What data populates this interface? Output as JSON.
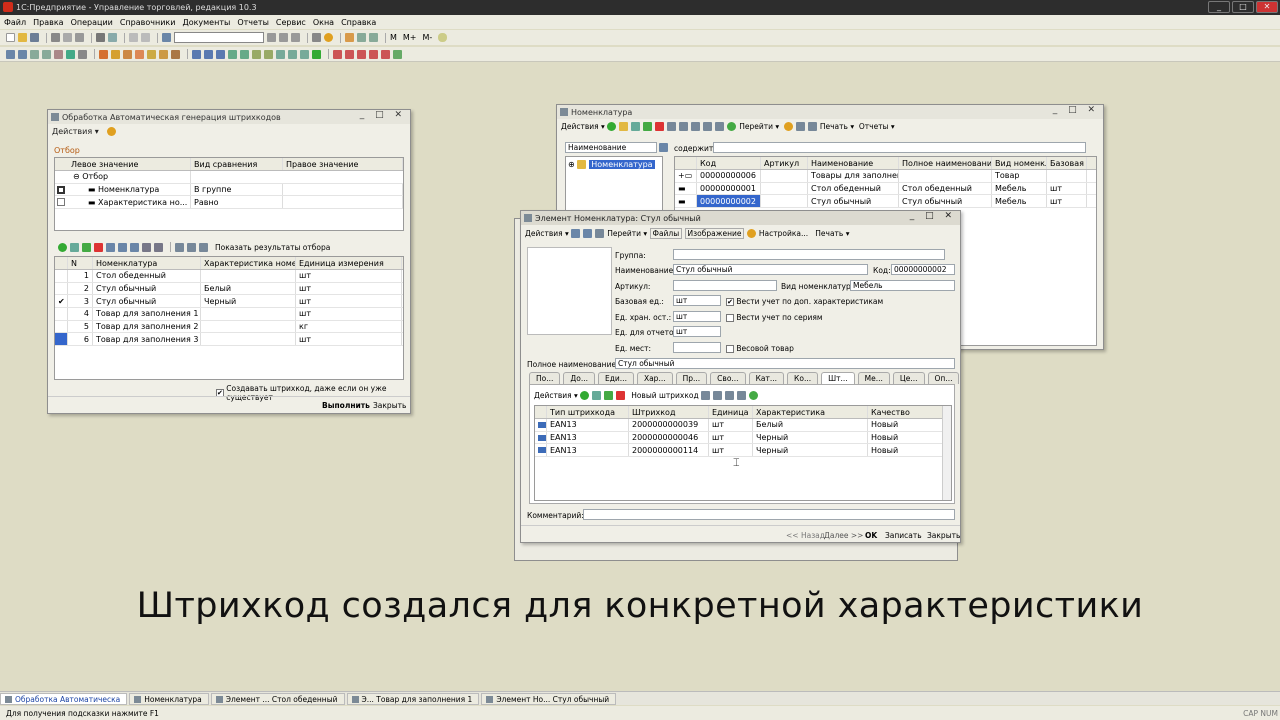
{
  "app": {
    "title": "1С:Предприятие - Управление торговлей, редакция 10.3",
    "menu": [
      "Файл",
      "Правка",
      "Операции",
      "Справочники",
      "Документы",
      "Отчеты",
      "Сервис",
      "Окна",
      "Справка"
    ],
    "toolbar_text": [
      "М",
      "М+",
      "М-"
    ]
  },
  "gen_window": {
    "title": "Обработка  Автоматическая генерация штрихкодов",
    "actions": "Действия",
    "filter_label": "Отбор",
    "filter_cols": [
      "Левое значение",
      "Вид сравнения",
      "Правое значение"
    ],
    "filter_root": "Отбор",
    "filters": [
      {
        "left": "Номенклатура",
        "cmp": "В группе",
        "right": ""
      },
      {
        "left": "Характеристика но...",
        "cmp": "Равно",
        "right": ""
      }
    ],
    "show_results": "Показать результаты отбора",
    "cols": [
      "N",
      "Номенклатура",
      "Характеристика номенк...",
      "Единица измерения"
    ],
    "rows": [
      {
        "n": "1",
        "name": "Стол обеденный",
        "char": "",
        "unit": "шт",
        "checked": false
      },
      {
        "n": "2",
        "name": "Стул обычный",
        "char": "Белый",
        "unit": "шт",
        "checked": false
      },
      {
        "n": "3",
        "name": "Стул обычный",
        "char": "Черный",
        "unit": "шт",
        "checked": true
      },
      {
        "n": "4",
        "name": "Товар для заполнения 1",
        "char": "",
        "unit": "шт",
        "checked": false
      },
      {
        "n": "5",
        "name": "Товар для заполнения 2",
        "char": "",
        "unit": "кг",
        "checked": false
      },
      {
        "n": "6",
        "name": "Товар для заполнения 3",
        "char": "",
        "unit": "шт",
        "checked": false
      }
    ],
    "create_note": "Создавать штрихкод, даже если он уже существует",
    "run": "Выполнить",
    "close": "Закрыть"
  },
  "nom_window": {
    "title": "Номенклатура",
    "toolbar": [
      "Действия",
      "Перейти",
      "Печать",
      "Отчеты"
    ],
    "search_field": "Наименование",
    "contains": "содержит:",
    "tree_root": "Номенклатура",
    "cols": [
      "Код",
      "Артикул",
      "Наименование",
      "Полное наименование",
      "Вид номенкл...",
      "Базовая ед..."
    ],
    "rows": [
      {
        "code": "00000000006",
        "art": "",
        "name": "Товары для заполнения",
        "full": "",
        "kind": "Товар",
        "unit": ""
      },
      {
        "code": "00000000001",
        "art": "",
        "name": "Стол обеденный",
        "full": "Стол обеденный",
        "kind": "Мебель",
        "unit": "шт"
      },
      {
        "code": "00000000002",
        "art": "",
        "name": "Стул обычный",
        "full": "Стул обычный",
        "kind": "Мебель",
        "unit": "шт"
      }
    ]
  },
  "el_window": {
    "title": "Элемент Номенклатура: Стул обычный",
    "toolbar": [
      "Действия",
      "Перейти",
      "Файлы",
      "Изображение",
      "Настройка...",
      "Печать"
    ],
    "group_label": "Группа:",
    "name_label": "Наименование:",
    "name_value": "Стул обычный",
    "code_label": "Код:",
    "code_value": "00000000002",
    "art_label": "Артикул:",
    "kind_label": "Вид номенклатуры:",
    "kind_value": "Мебель",
    "base_label": "Базовая ед.:",
    "base_value": "шт",
    "store_label": "Ед. хран. ост.:",
    "store_value": "шт",
    "report_label": "Ед. для отчетов:",
    "report_value": "шт",
    "place_label": "Ед. мест:",
    "chk_char": "Вести учет по доп. характеристикам",
    "chk_series": "Вести учет по сериям",
    "chk_weight": "Весовой товар",
    "full_label": "Полное наименование:",
    "full_value": "Стул обычный",
    "tabs": [
      "По...",
      "До...",
      "Еди...",
      "Хар...",
      "Пр...",
      "Сво...",
      "Кат...",
      "Ко...",
      "Шт...",
      "Ме...",
      "Це...",
      "Оп..."
    ],
    "sub_actions": "Действия",
    "new_barcode": "Новый штрихкод",
    "bc_cols": [
      "Тип штрихкода",
      "Штрихкод",
      "Единица",
      "Характеристика",
      "Качество"
    ],
    "bc_rows": [
      {
        "type": "EAN13",
        "code": "2000000000039",
        "unit": "шт",
        "char": "Белый",
        "q": "Новый"
      },
      {
        "type": "EAN13",
        "code": "2000000000046",
        "unit": "шт",
        "char": "Черный",
        "q": "Новый"
      },
      {
        "type": "EAN13",
        "code": "2000000000114",
        "unit": "шт",
        "char": "Черный",
        "q": "Новый"
      }
    ],
    "comment_label": "Комментарий:",
    "btn_back": "<< Назад",
    "btn_next": "Далее >>",
    "btn_ok": "OK",
    "btn_save": "Записать",
    "btn_close": "Закрыть"
  },
  "taskbar": [
    "Обработка  Автоматическа",
    "Номенклатура",
    "Элемент ... Стол обеденный",
    "Э...  Товар для заполнения 1",
    "Элемент Но... Стул обычный"
  ],
  "status": {
    "hint": "Для получения подсказки нажмите F1",
    "caps": "CAP",
    "num": "NUM"
  },
  "caption": "Штрихкод создался для конкретной характеристики"
}
